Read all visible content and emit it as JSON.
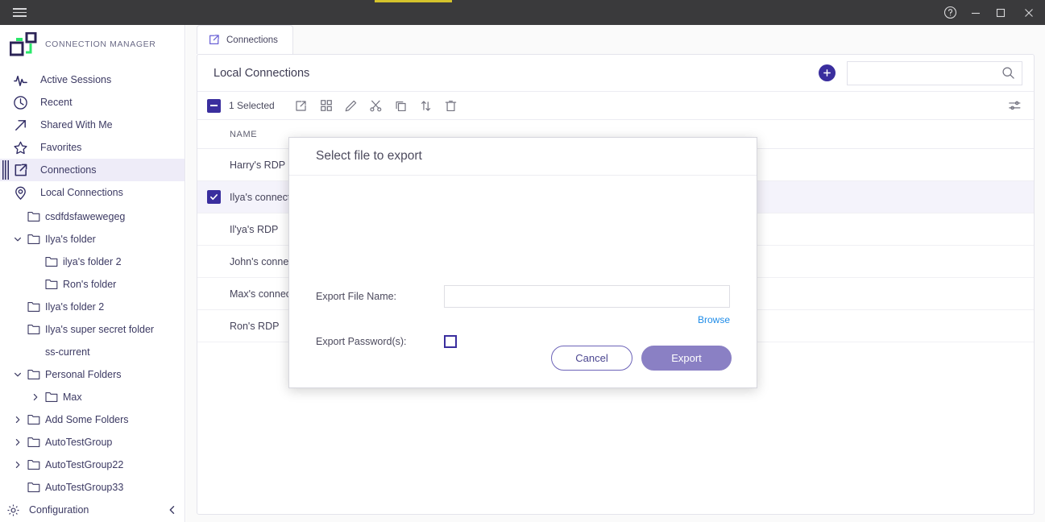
{
  "titlebar": {
    "menu_icon": "hamburger-icon",
    "help_icon": "help-circle-icon",
    "minimize_icon": "minimize-icon",
    "maximize_icon": "maximize-icon",
    "close_icon": "close-icon",
    "accent_color": "#d4c32c"
  },
  "sidebar": {
    "brand": "CONNECTION MANAGER",
    "logo_colors": {
      "dark": "#2b2356",
      "green": "#2ae86a"
    },
    "nav": [
      {
        "label": "Active Sessions",
        "icon": "activity-pulse-icon",
        "active": false
      },
      {
        "label": "Recent",
        "icon": "clock-icon",
        "active": false
      },
      {
        "label": "Shared With Me",
        "icon": "arrow-up-right-icon",
        "active": false
      },
      {
        "label": "Favorites",
        "icon": "star-icon",
        "active": false
      },
      {
        "label": "Connections",
        "icon": "external-link-icon",
        "active": true
      },
      {
        "label": "Local Connections",
        "icon": "location-pin-icon",
        "active": false
      }
    ],
    "tree": [
      {
        "label": "csdfdsfawewegeg",
        "indent": 1,
        "caret": "none",
        "folder": true
      },
      {
        "label": "Ilya's folder",
        "indent": 1,
        "caret": "down",
        "folder": true
      },
      {
        "label": "ilya's folder 2",
        "indent": 2,
        "caret": "none",
        "folder": true
      },
      {
        "label": "Ron's folder",
        "indent": 2,
        "caret": "none",
        "folder": true
      },
      {
        "label": "Ilya's folder 2",
        "indent": 1,
        "caret": "none",
        "folder": true
      },
      {
        "label": "Ilya's super secret folder",
        "indent": 1,
        "caret": "none",
        "folder": true
      },
      {
        "label": "ss-current",
        "indent": 1,
        "caret": "none",
        "folder": false
      },
      {
        "label": "Personal Folders",
        "indent": 1,
        "caret": "down",
        "folder": true
      },
      {
        "label": "Max",
        "indent": 2,
        "caret": "right",
        "folder": true
      },
      {
        "label": "Add Some Folders",
        "indent": 1,
        "caret": "right",
        "folder": true
      },
      {
        "label": "AutoTestGroup",
        "indent": 1,
        "caret": "right",
        "folder": true
      },
      {
        "label": "AutoTestGroup22",
        "indent": 1,
        "caret": "right",
        "folder": true
      },
      {
        "label": "AutoTestGroup33",
        "indent": 1,
        "caret": "none",
        "folder": true
      }
    ],
    "configuration": {
      "label": "Configuration",
      "icon": "gear-icon",
      "collapse_icon": "chevron-left-icon"
    }
  },
  "main": {
    "tabs": [
      {
        "label": "Connections",
        "icon": "external-link-icon",
        "active": true
      }
    ],
    "panel_title": "Local Connections",
    "add_button_label": "+",
    "search": {
      "value": "",
      "placeholder": ""
    },
    "toolbar": {
      "selected_count": "1",
      "selected_label": "Selected",
      "icons": [
        "open-external-icon",
        "grid-view-icon",
        "edit-pencil-icon",
        "cut-scissors-icon",
        "copy-icon",
        "sort-arrows-icon",
        "delete-trash-icon"
      ],
      "settings_icon": "sliders-icon"
    },
    "columns": [
      "NAME"
    ],
    "rows": [
      {
        "name": "Harry's RDP",
        "checked": false
      },
      {
        "name": "Ilya's connection",
        "checked": true
      },
      {
        "name": "Il'ya's RDP",
        "checked": false
      },
      {
        "name": "John's connection",
        "checked": false
      },
      {
        "name": "Max's connection",
        "checked": false
      },
      {
        "name": "Ron's RDP",
        "checked": false
      }
    ]
  },
  "modal": {
    "title": "Select file to export",
    "filename_label": "Export File Name:",
    "filename_value": "",
    "filename_placeholder": "",
    "browse_label": "Browse",
    "password_label": "Export Password(s):",
    "password_checked": false,
    "cancel_label": "Cancel",
    "export_label": "Export",
    "export_button_color": "#8a80c4"
  }
}
